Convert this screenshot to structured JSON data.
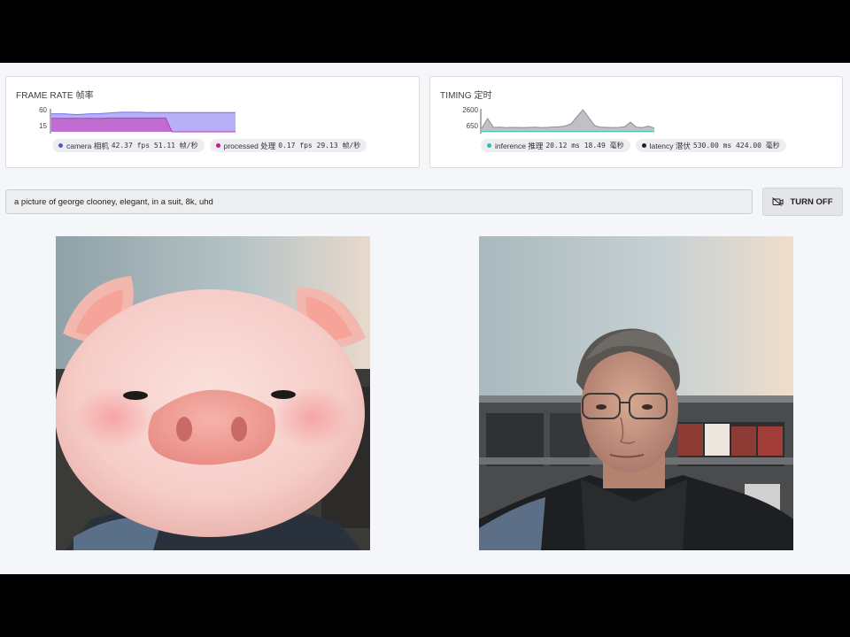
{
  "frame_rate_panel": {
    "title": "FRAME RATE 帧率",
    "chart_data": {
      "type": "area",
      "ylabels": [
        "60",
        "15"
      ],
      "series": [
        {
          "name": "camera",
          "color": "#7b6ff0",
          "values": [
            47,
            47,
            47,
            46,
            45,
            46,
            47,
            47,
            48,
            49,
            50,
            51,
            51,
            51,
            51,
            50,
            50,
            50,
            50,
            50,
            50,
            50,
            50,
            50,
            50,
            50,
            50,
            50,
            50,
            50
          ]
        },
        {
          "name": "processed",
          "color": "#c737b1",
          "values": [
            35,
            35,
            35,
            35,
            35,
            35,
            35,
            35,
            35,
            36,
            36,
            36,
            36,
            36,
            36,
            36,
            36,
            36,
            36,
            0,
            0,
            0,
            0,
            0,
            0,
            0,
            0,
            0,
            0,
            0
          ]
        }
      ]
    },
    "legend": [
      {
        "dot": "#5b57b3",
        "label": "camera 相机",
        "value": "42.37 fps 51.11 帧/秒"
      },
      {
        "dot": "#c21d8e",
        "label": "processed 处理",
        "value": "0.17 fps 29.13 帧/秒"
      }
    ]
  },
  "timing_panel": {
    "title": "TIMING 定时",
    "chart_data": {
      "type": "area",
      "ylabels": [
        "2600",
        "650"
      ],
      "series": [
        {
          "name": "latency",
          "color": "#8c8c96",
          "values": [
            400,
            1500,
            500,
            520,
            480,
            500,
            490,
            470,
            500,
            520,
            480,
            500,
            540,
            560,
            650,
            900,
            1700,
            2500,
            1600,
            700,
            520,
            500,
            480,
            500,
            560,
            1100,
            520,
            480,
            650,
            430
          ]
        },
        {
          "name": "inference",
          "color": "#2bbfb3",
          "values": [
            20,
            20,
            20,
            20,
            20,
            20,
            20,
            20,
            20,
            20,
            20,
            20,
            20,
            20,
            20,
            20,
            20,
            20,
            20,
            20,
            20,
            20,
            20,
            20,
            20,
            20,
            20,
            20,
            20,
            20
          ]
        }
      ]
    },
    "legend": [
      {
        "dot": "#2bbfb3",
        "label": "inference 推理",
        "value": "20.12 ms 18.49 毫秒"
      },
      {
        "dot": "#222222",
        "label": "latency 潜伏",
        "value": "530.00 ms 424.00 毫秒"
      }
    ]
  },
  "prompt": {
    "value": "a picture of george clooney, elegant, in a suit, 8k, uhd"
  },
  "button": {
    "label": "TURN OFF",
    "icon": "video-off-icon"
  }
}
